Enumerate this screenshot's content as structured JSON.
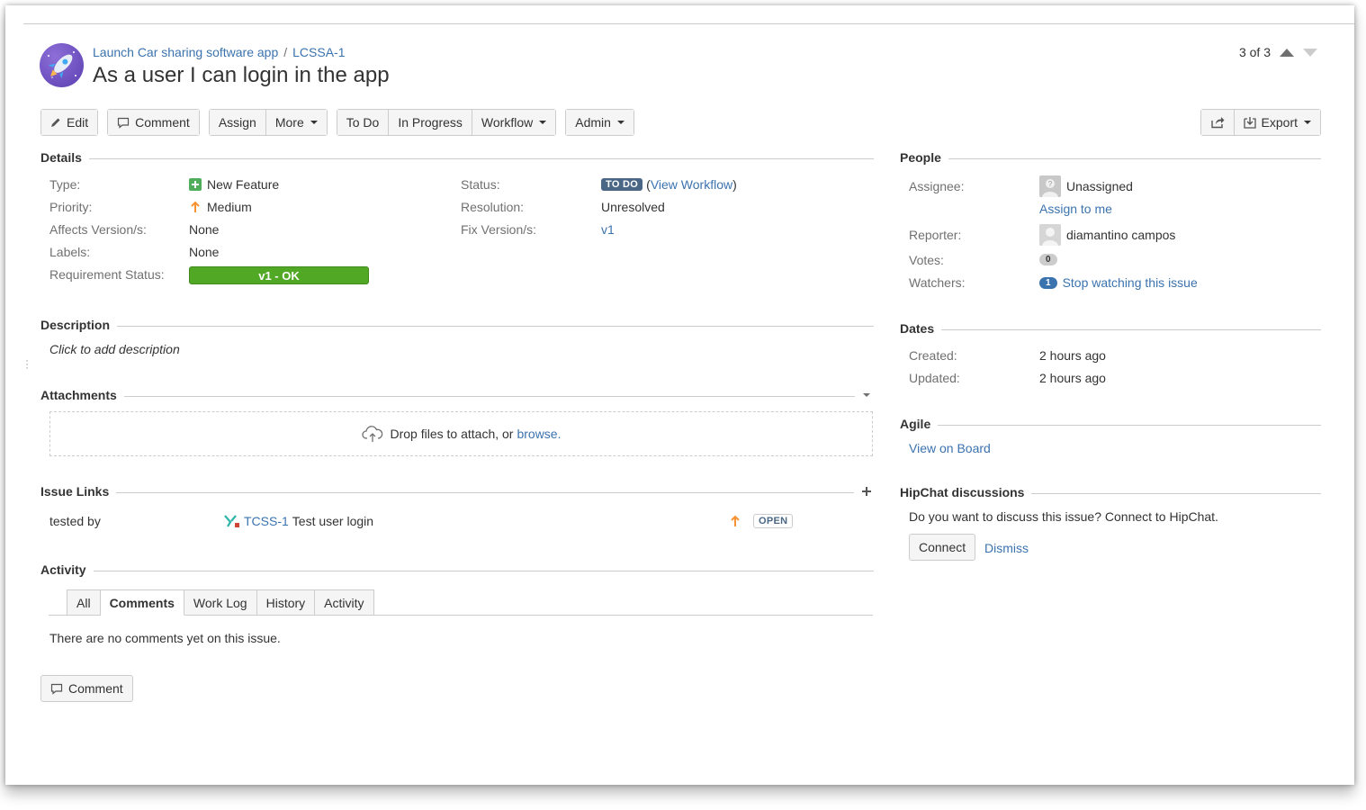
{
  "header": {
    "project_link": "Launch Car sharing software app",
    "separator": "/",
    "issue_key": "LCSSA-1",
    "title": "As a user I can login in the app",
    "pager_text": "3 of 3"
  },
  "toolbar": {
    "edit": "Edit",
    "comment": "Comment",
    "assign": "Assign",
    "more": "More",
    "todo": "To Do",
    "in_progress": "In Progress",
    "workflow": "Workflow",
    "admin": "Admin",
    "export": "Export"
  },
  "details": {
    "heading": "Details",
    "type_label": "Type:",
    "type_value": "New Feature",
    "priority_label": "Priority:",
    "priority_value": "Medium",
    "affects_label": "Affects Version/s:",
    "affects_value": "None",
    "labels_label": "Labels:",
    "labels_value": "None",
    "req_label": "Requirement Status:",
    "req_value": "v1 - OK",
    "status_label": "Status:",
    "status_value": "TO DO",
    "status_paren_open": "(",
    "view_workflow": "View Workflow",
    "status_paren_close": ")",
    "resolution_label": "Resolution:",
    "resolution_value": "Unresolved",
    "fix_label": "Fix Version/s:",
    "fix_value": "v1"
  },
  "description": {
    "heading": "Description",
    "placeholder": "Click to add description"
  },
  "attachments": {
    "heading": "Attachments",
    "drop_text": "Drop files to attach, or",
    "browse": "browse."
  },
  "issue_links": {
    "heading": "Issue Links",
    "relation": "tested by",
    "linked_key": "TCSS-1",
    "linked_summary": "Test user login",
    "linked_status": "OPEN"
  },
  "activity": {
    "heading": "Activity",
    "tabs": [
      "All",
      "Comments",
      "Work Log",
      "History",
      "Activity"
    ],
    "active_tab": "Comments",
    "empty_text": "There are no comments yet on this issue.",
    "comment_button": "Comment"
  },
  "people": {
    "heading": "People",
    "assignee_label": "Assignee:",
    "assignee_value": "Unassigned",
    "assign_to_me": "Assign to me",
    "reporter_label": "Reporter:",
    "reporter_value": "diamantino campos",
    "votes_label": "Votes:",
    "votes_count": "0",
    "watchers_label": "Watchers:",
    "watchers_count": "1",
    "stop_watching": "Stop watching this issue"
  },
  "dates": {
    "heading": "Dates",
    "created_label": "Created:",
    "created_value": "2 hours ago",
    "updated_label": "Updated:",
    "updated_value": "2 hours ago"
  },
  "agile": {
    "heading": "Agile",
    "view_on_board": "View on Board"
  },
  "hipchat": {
    "heading": "HipChat discussions",
    "prompt": "Do you want to discuss this issue? Connect to HipChat.",
    "connect": "Connect",
    "dismiss": "Dismiss"
  },
  "colors": {
    "link": "#3b73af",
    "status_todo": "#4a6785",
    "requirement_ok": "#51a825",
    "priority_medium": "#f79232",
    "feature_icon": "#4fad5b"
  }
}
